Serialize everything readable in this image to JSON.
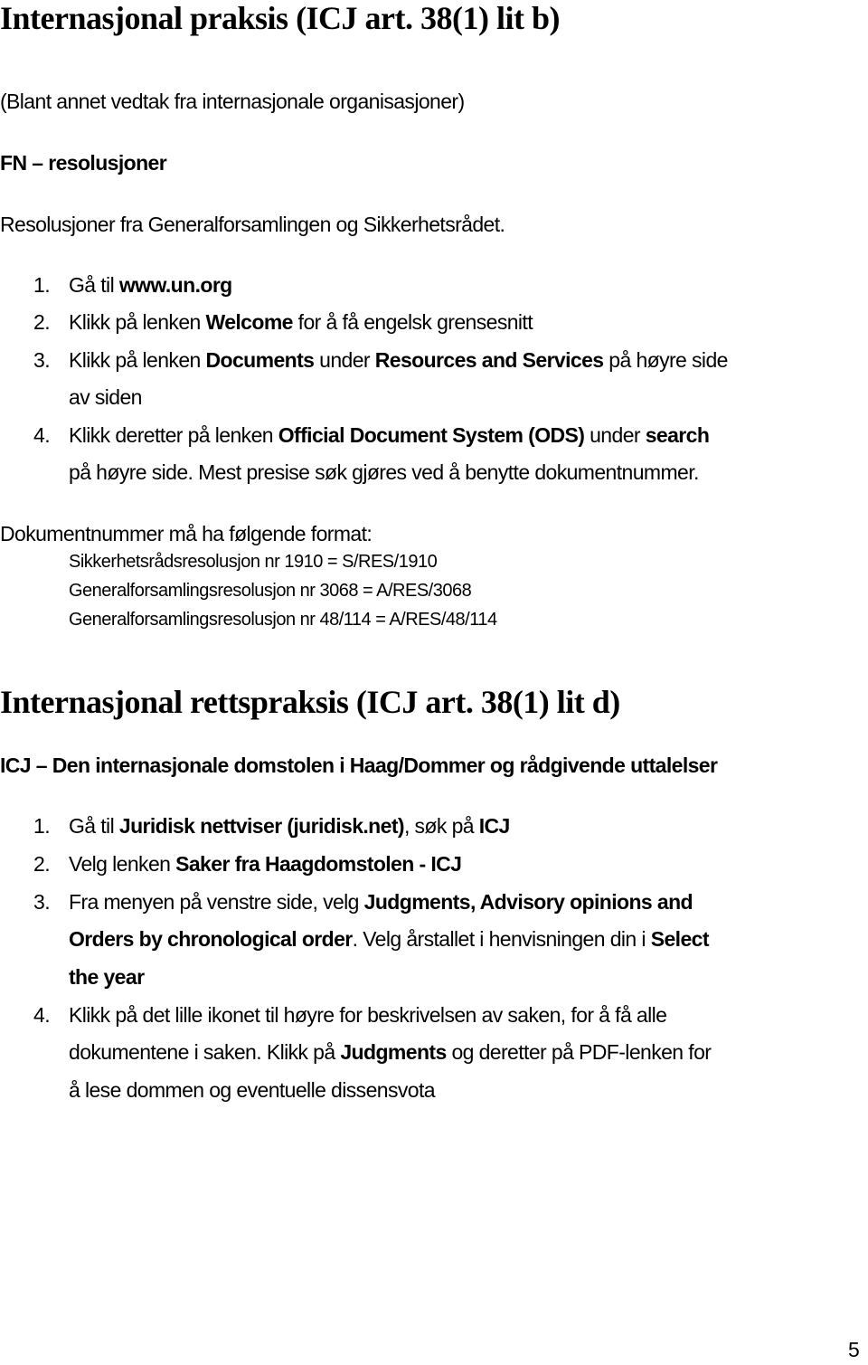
{
  "section1": {
    "heading": "Internasjonal praksis (ICJ art. 38(1) lit b)",
    "subtitle": "(Blant annet vedtak fra internasjonale organisasjoner)",
    "subheading": "FN – resolusjoner",
    "intro": "Resolusjoner fra Generalforsamlingen og Sikkerhetsrådet.",
    "steps": [
      {
        "num": "1.",
        "t1": "Gå til ",
        "b1": "www.un.org"
      },
      {
        "num": "2.",
        "t1": "Klikk på lenken ",
        "b1": "Welcome",
        "t2": " for å få engelsk grensesnitt"
      },
      {
        "num": "3.",
        "t1": "Klikk på lenken ",
        "b1": "Documents",
        "t2": " under ",
        "b2": "Resources and Services",
        "t3": " på høyre side",
        "cont": "av siden"
      },
      {
        "num": "4.",
        "t1": "Klikk deretter på lenken ",
        "b1": "Official Document System (ODS)",
        "t2": " under ",
        "b2": "search",
        "cont": "på høyre side. Mest presise søk gjøres ved å benytte dokumentnummer."
      }
    ],
    "format_intro": "Dokumentnummer må ha følgende format:",
    "formats": [
      "Sikkerhetsrådsresolusjon nr 1910 = S/RES/1910",
      "Generalforsamlingsresolusjon nr 3068 = A/RES/3068",
      "Generalforsamlingsresolusjon nr 48/114 = A/RES/48/114"
    ]
  },
  "section2": {
    "heading": "Internasjonal rettspraksis (ICJ art. 38(1) lit d)",
    "subheading": "ICJ – Den internasjonale domstolen i Haag/Dommer og rådgivende uttalelser",
    "steps": [
      {
        "num": "1.",
        "t1": "Gå til ",
        "b1": "Juridisk nettviser (juridisk.net)",
        "t2": ", søk på ",
        "b2": "ICJ"
      },
      {
        "num": "2.",
        "t1": "Velg lenken ",
        "b1": "Saker fra Haagdomstolen - ICJ"
      },
      {
        "num": "3.",
        "t1": "Fra menyen på venstre side, velg ",
        "b1": "Judgments, Advisory opinions and",
        "c_b1": "Orders by chronological order",
        "c_t1": ". Velg årstallet i henvisningen din i ",
        "c_b2": "Select",
        "c2_b1": "the year"
      },
      {
        "num": "4.",
        "t1": "Klikk på det lille ikonet til høyre for beskrivelsen av saken, for å få alle",
        "c_t1": "dokumentene i saken. Klikk på ",
        "c_b1": "Judgments",
        "c_t2": " og deretter på PDF-lenken for",
        "c2_t1": "å lese dommen og eventuelle dissensvota"
      }
    ]
  },
  "page_number": "5"
}
